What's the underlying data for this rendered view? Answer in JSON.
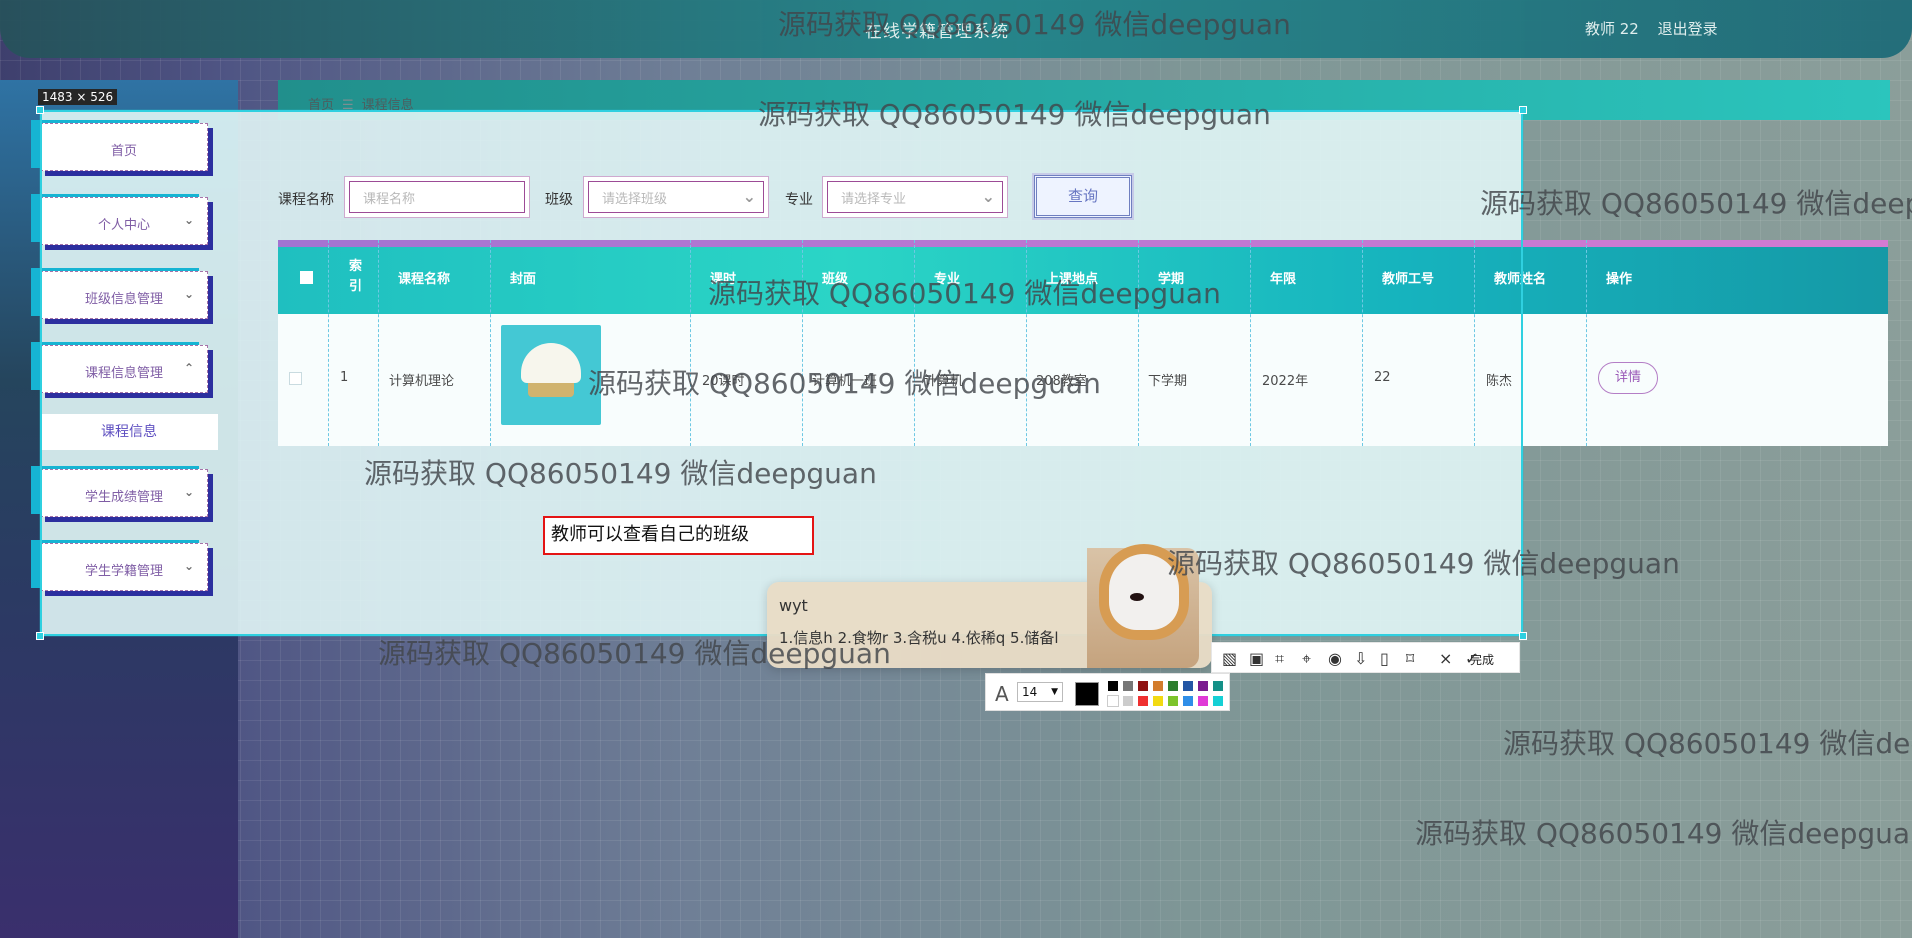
{
  "topbar": {
    "title": "在线学籍管理系统",
    "user": "教师 22",
    "logout": "退出登录"
  },
  "capture": {
    "size": "1483 × 526"
  },
  "sidebar": {
    "items": [
      {
        "label": "首页"
      },
      {
        "label": "个人中心"
      },
      {
        "label": "班级信息管理"
      },
      {
        "label": "课程信息管理"
      },
      {
        "label": "学生成绩管理"
      },
      {
        "label": "学生学籍管理"
      }
    ],
    "submenu": "课程信息"
  },
  "breadcrumb": {
    "home": "首页",
    "sep": "☰",
    "current": "课程信息"
  },
  "filters": {
    "course_label": "课程名称",
    "course_placeholder": "课程名称",
    "class_label": "班级",
    "class_placeholder": "请选择班级",
    "major_label": "专业",
    "major_placeholder": "请选择专业",
    "query": "查询"
  },
  "table": {
    "headers": [
      "索引",
      "课程名称",
      "封面",
      "课时",
      "班级",
      "专业",
      "上课地点",
      "学期",
      "年限",
      "教师工号",
      "教师姓名",
      "操作"
    ],
    "row": {
      "index": "1",
      "course": "计算机理论",
      "hours": "20课时",
      "class": "计算机一班",
      "major": "计算机",
      "location": "208教室",
      "term": "下学期",
      "year": "2022年",
      "teacher_id": "22",
      "teacher_name": "陈杰",
      "action": "详情"
    }
  },
  "annotation": {
    "text": "教师可以查看自己的班级"
  },
  "ime": {
    "composition": "wyt",
    "candidates": "1.信息h  2.食物r  3.含税u  4.依稀q  5.储备l"
  },
  "screenshot_tools": {
    "done": "完成",
    "font_size": "14"
  },
  "watermarks": [
    "源码获取 QQ86050149 微信deepguan",
    "源码获取 QQ86050149 微信deepguan",
    "源码获取 QQ86050149 微信deepguan",
    "源码获取 QQ86050149 微信deepguan",
    "源码获取 QQ86050149 微信deepguan",
    "源码获取 QQ86050149 微信deepguan",
    "源码获取 QQ86050149 微信deepguan",
    "源码获取 QQ86050149 微信deepguan",
    "源码获取 QQ86050149 微信deepguan",
    "源码获取 QQ86050149 微信deepguan"
  ]
}
